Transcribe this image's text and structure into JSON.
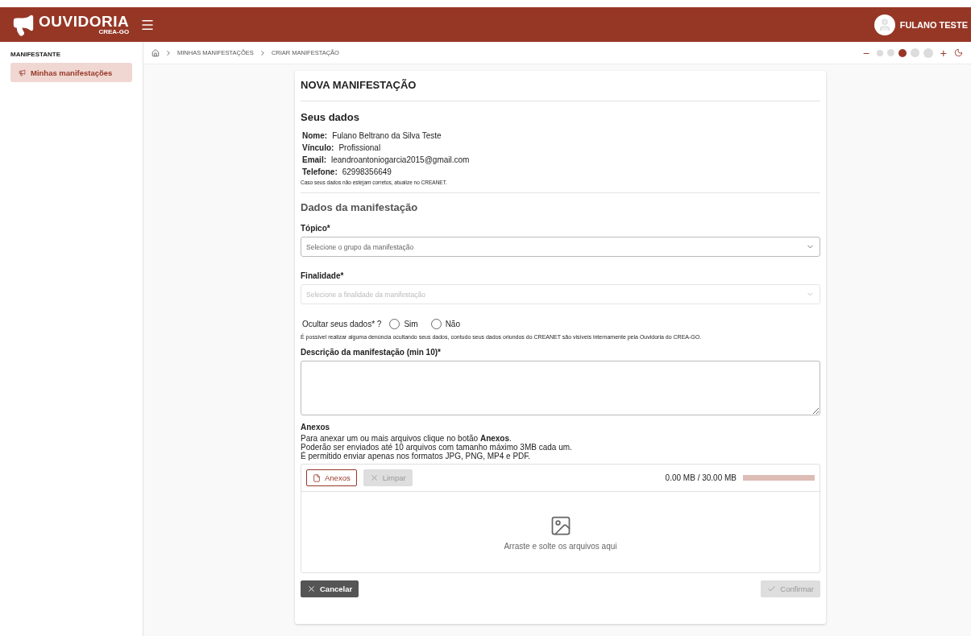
{
  "header": {
    "logo_title": "OUVIDORIA",
    "logo_subtitle": "CREA-GO",
    "user_name": "FULANO TESTE"
  },
  "sidebar": {
    "section": "MANIFESTANTE",
    "items": [
      {
        "label": "Minhas manifestações",
        "selected": true
      }
    ]
  },
  "breadcrumb": [
    "MINHAS MANIFESTAÇÕES",
    "CRIAR MANIFESTAÇÃO"
  ],
  "font_scale": {
    "minus": "−",
    "plus": "+",
    "steps": [
      {
        "selected": false
      },
      {
        "selected": false
      },
      {
        "selected": true
      },
      {
        "selected": false
      },
      {
        "selected": false
      }
    ]
  },
  "form": {
    "title": "NOVA MANIFESTAÇÃO",
    "your_data": {
      "heading": "Seus dados",
      "fields": [
        {
          "label": "Nome:",
          "value": "Fulano Beltrano da Silva Teste"
        },
        {
          "label": "Vínculo:",
          "value": "Profissional"
        },
        {
          "label": "Email:",
          "value": "leandroantoniogarcia2015@gmail.com"
        },
        {
          "label": "Telefone:",
          "value": "62998356649"
        }
      ],
      "note": "Caso seus dados não estejam corretos, atualize no CREANET."
    },
    "heading": "Dados da manifestação",
    "selects": [
      {
        "label": "Tópico*",
        "placeholder": "Selecione o grupo da manifestação",
        "disabled": false
      },
      {
        "label": "Finalidade*",
        "placeholder": "Selecione a finalidade da manifestação",
        "disabled": true
      }
    ],
    "hide_data": {
      "label": "Ocultar seus dados* ?",
      "options": [
        {
          "label": "Sim",
          "selected": false
        },
        {
          "label": "Não",
          "selected": false
        }
      ],
      "hint": "É possível realizar alguma denúncia ocultando seus dados, contudo seus dados oriundos do CREANET são visíveis internamente pela Ouvidoria do CREA-GO."
    },
    "description_label": "Descrição da manifestação (min 10)*",
    "attachments": {
      "label": "Anexos",
      "help": [
        "Para anexar um ou mais arquivos clique no botão **Anexos**.",
        "Poderão ser enviados até 10 arquivos com tamanho máximo 3MB cada um.",
        "É permitido enviar apenas nos formatos JPG, PNG, MP4 e PDF."
      ],
      "add_button": "Anexos",
      "clear_button": {
        "label": "Limpar",
        "disabled": true
      },
      "size": "0.00 MB / 30.00 MB",
      "level": 0,
      "drop_text": "Arraste e solte os arquivos aqui"
    },
    "cancel_button": "Cancelar",
    "confirm_button": {
      "label": "Confirmar",
      "disabled": true
    }
  }
}
